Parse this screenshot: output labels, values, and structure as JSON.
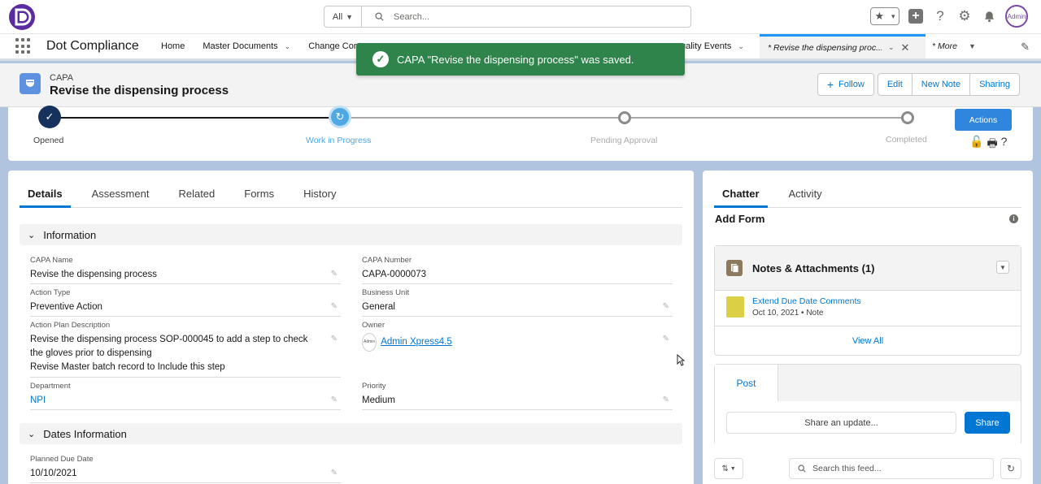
{
  "header": {
    "search_scope": "All",
    "search_placeholder": "Search...",
    "avatar_label": "Admin"
  },
  "nav": {
    "app_name": "Dot Compliance",
    "items": [
      {
        "label": "Home",
        "has_menu": false
      },
      {
        "label": "Master Documents",
        "has_menu": true
      },
      {
        "label": "Change Cont",
        "has_menu": false
      }
    ],
    "right_item": "uality Events",
    "active_tab": "* Revise the dispensing proc...",
    "more": "* More"
  },
  "toast": {
    "message": "CAPA \"Revise the dispensing process\" was saved."
  },
  "record": {
    "type": "CAPA",
    "title": "Revise the dispensing process",
    "buttons": {
      "follow": "Follow",
      "edit": "Edit",
      "new_note": "New Note",
      "sharing": "Sharing"
    }
  },
  "path": {
    "steps": [
      "Opened",
      "Work in Progress",
      "Pending Approval",
      "Completed"
    ],
    "current_index": 1,
    "actions_label": "Actions"
  },
  "details": {
    "tabs": [
      "Details",
      "Assessment",
      "Related",
      "Forms",
      "History"
    ],
    "info_section": "Information",
    "fields": {
      "capa_name": {
        "label": "CAPA Name",
        "value": "Revise the dispensing process"
      },
      "capa_number": {
        "label": "CAPA Number",
        "value": "CAPA-0000073"
      },
      "action_type": {
        "label": "Action Type",
        "value": "Preventive Action"
      },
      "business_unit": {
        "label": "Business Unit",
        "value": "General"
      },
      "plan_desc": {
        "label": "Action Plan Description",
        "line1": "Revise the dispensing process SOP-000045 to add a step to check",
        "line2": "the gloves prior to dispensing",
        "line3": "Revise Master batch record to Include this step"
      },
      "owner": {
        "label": "Owner",
        "value": "Admin Xpress4.5",
        "avatar": "Admin"
      },
      "department": {
        "label": "Department",
        "value": "NPI"
      },
      "priority": {
        "label": "Priority",
        "value": "Medium"
      }
    },
    "dates_section": "Dates Information",
    "planned_due": {
      "label": "Planned Due Date",
      "value": "10/10/2021"
    }
  },
  "side": {
    "tabs": [
      "Chatter",
      "Activity"
    ],
    "add_form": "Add Form",
    "notes": {
      "title": "Notes & Attachments (1)",
      "item_title": "Extend Due Date Comments",
      "item_meta": "Oct 10, 2021 • Note",
      "view_all": "View All"
    },
    "post": {
      "tab": "Post",
      "placeholder": "Share an update...",
      "share": "Share"
    },
    "feed_search": "Search this feed..."
  }
}
